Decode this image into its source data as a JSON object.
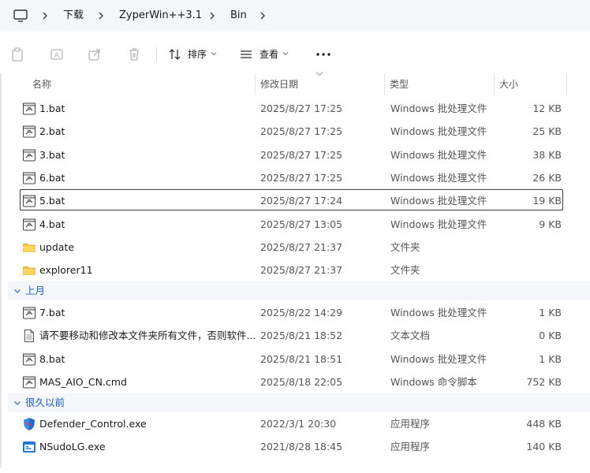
{
  "breadcrumb": {
    "items": [
      "下载",
      "ZyperWin++3.1",
      "Bin"
    ]
  },
  "toolbar": {
    "sort_label": "排序",
    "view_label": "查看"
  },
  "columns": {
    "name": "名称",
    "date": "修改日期",
    "type": "类型",
    "size": "大小"
  },
  "rows_group1": [
    {
      "name": "1.bat",
      "date": "2025/8/27 17:25",
      "type": "Windows 批处理文件",
      "size": "12 KB",
      "icon": "batch-file-icon"
    },
    {
      "name": "2.bat",
      "date": "2025/8/27 17:25",
      "type": "Windows 批处理文件",
      "size": "25 KB",
      "icon": "batch-file-icon"
    },
    {
      "name": "3.bat",
      "date": "2025/8/27 17:25",
      "type": "Windows 批处理文件",
      "size": "38 KB",
      "icon": "batch-file-icon"
    },
    {
      "name": "6.bat",
      "date": "2025/8/27 17:25",
      "type": "Windows 批处理文件",
      "size": "26 KB",
      "icon": "batch-file-icon"
    },
    {
      "name": "5.bat",
      "date": "2025/8/27 17:24",
      "type": "Windows 批处理文件",
      "size": "19 KB",
      "icon": "batch-file-icon",
      "selected": true
    },
    {
      "name": "4.bat",
      "date": "2025/8/27 13:05",
      "type": "Windows 批处理文件",
      "size": "9 KB",
      "icon": "batch-file-icon"
    },
    {
      "name": "update",
      "date": "2025/8/27 21:37",
      "type": "文件夹",
      "size": "",
      "icon": "folder-icon"
    },
    {
      "name": "explorer11",
      "date": "2025/8/27 21:37",
      "type": "文件夹",
      "size": "",
      "icon": "folder-icon"
    }
  ],
  "group2": {
    "label": "上月"
  },
  "rows_group2": [
    {
      "name": "7.bat",
      "date": "2025/8/22 14:29",
      "type": "Windows 批处理文件",
      "size": "1 KB",
      "icon": "batch-file-icon"
    },
    {
      "name": "请不要移动和修改本文件夹所有文件，否则软件...",
      "date": "2025/8/21 18:52",
      "type": "文本文档",
      "size": "0 KB",
      "icon": "text-file-icon"
    },
    {
      "name": "8.bat",
      "date": "2025/8/21 18:51",
      "type": "Windows 批处理文件",
      "size": "1 KB",
      "icon": "batch-file-icon"
    },
    {
      "name": "MAS_AIO_CN.cmd",
      "date": "2025/8/18 22:05",
      "type": "Windows 命令脚本",
      "size": "752 KB",
      "icon": "batch-file-icon"
    }
  ],
  "group3": {
    "label": "很久以前"
  },
  "rows_group3": [
    {
      "name": "Defender_Control.exe",
      "date": "2022/3/1 20:30",
      "type": "应用程序",
      "size": "448 KB",
      "icon": "shield-app-icon"
    },
    {
      "name": "NSudoLG.exe",
      "date": "2021/8/28 18:45",
      "type": "应用程序",
      "size": "140 KB",
      "icon": "app-window-icon"
    }
  ]
}
